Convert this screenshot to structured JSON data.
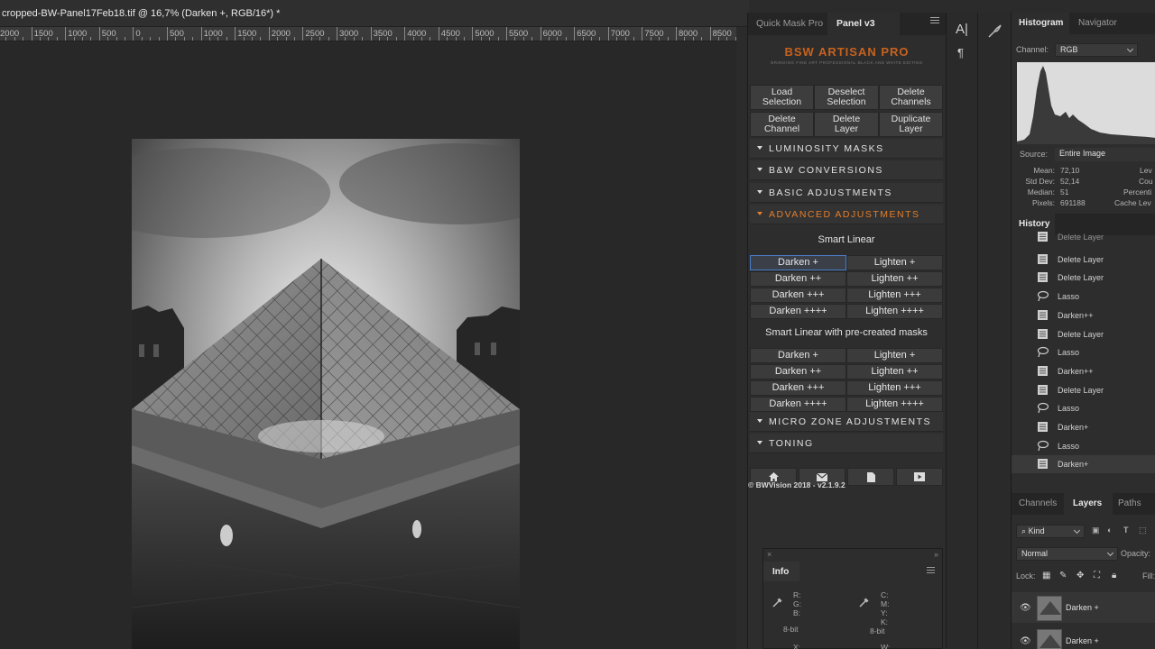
{
  "document": {
    "title": "cropped-BW-Panel17Feb18.tif @ 16,7% (Darken +, RGB/16*) *"
  },
  "ruler": {
    "ticks": [
      "2000",
      "1500",
      "1000",
      "500",
      "0",
      "500",
      "1000",
      "1500",
      "2000",
      "2500",
      "3000",
      "3500",
      "4000",
      "4500",
      "5000",
      "5500",
      "6000",
      "6500",
      "7000",
      "7500",
      "8000",
      "8500"
    ]
  },
  "bwa_panel": {
    "tabs": [
      "Quick Mask Pro",
      "Panel v3"
    ],
    "logo": "BSW ARTISAN PRO",
    "logo_sub": "BRINGING FINE ART PROFESSIONAL BLACK AND WHITE EDITING",
    "buttons": [
      [
        "Load",
        "Selection"
      ],
      [
        "Deselect",
        "Selection"
      ],
      [
        "Delete",
        "Channels"
      ],
      [
        "Delete",
        "Channel"
      ],
      [
        "Delete",
        "Layer"
      ],
      [
        "Duplicate",
        "Layer"
      ]
    ],
    "sections": {
      "luminosity": "LUMINOSITY MASKS",
      "bw": "B&W CONVERSIONS",
      "basic": "BASIC ADJUSTMENTS",
      "advanced": "ADVANCED ADJUSTMENTS",
      "micro": "MICRO ZONE ADJUSTMENTS",
      "toning": "TONING"
    },
    "smart_linear_heading": "Smart Linear",
    "smart_linear": {
      "darken": [
        "Darken +",
        "Darken ++",
        "Darken +++",
        "Darken ++++"
      ],
      "lighten": [
        "Lighten +",
        "Lighten ++",
        "Lighten +++",
        "Lighten ++++"
      ]
    },
    "smart_linear_masks_heading": "Smart Linear with pre-created masks",
    "smart_linear_masks": {
      "darken": [
        "Darken +",
        "Darken ++",
        "Darken +++",
        "Darken ++++"
      ],
      "lighten": [
        "Lighten +",
        "Lighten ++",
        "Lighten +++",
        "Lighten ++++"
      ]
    },
    "footer_icons": [
      "home-icon",
      "mail-icon",
      "document-icon",
      "video-icon"
    ],
    "copyright": "© BWVision 2018 - v2.1.9.2",
    "active_color": "#e57e2a"
  },
  "info_panel": {
    "title": "Info",
    "left_labels": [
      "R:",
      "G:",
      "B:"
    ],
    "left_depth": "8-bit",
    "right_labels": [
      "C:",
      "M:",
      "Y:",
      "K:"
    ],
    "right_depth": "8-bit",
    "bottom_left": "X:",
    "bottom_right": "W:"
  },
  "histogram": {
    "tabs": [
      "Histogram",
      "Navigator"
    ],
    "channel_label": "Channel:",
    "channel_value": "RGB",
    "source_label": "Source:",
    "source_value": "Entire Image",
    "stats": [
      {
        "label": "Mean:",
        "value": "72,10"
      },
      {
        "label": "Std Dev:",
        "value": "52,14"
      },
      {
        "label": "Median:",
        "value": "51"
      },
      {
        "label": "Pixels:",
        "value": "691188"
      }
    ],
    "right_stats": [
      "Lev",
      "Cou",
      "Percenti",
      "Cache Lev"
    ]
  },
  "history": {
    "title": "History",
    "items": [
      {
        "label": "Delete Layer",
        "icon": "document-icon"
      },
      {
        "label": "Delete Layer",
        "icon": "document-icon"
      },
      {
        "label": "Delete Layer",
        "icon": "document-icon"
      },
      {
        "label": "Lasso",
        "icon": "lasso-icon"
      },
      {
        "label": "Darken++",
        "icon": "document-icon"
      },
      {
        "label": "Delete Layer",
        "icon": "document-icon"
      },
      {
        "label": "Lasso",
        "icon": "lasso-icon"
      },
      {
        "label": "Darken++",
        "icon": "document-icon"
      },
      {
        "label": "Delete Layer",
        "icon": "document-icon"
      },
      {
        "label": "Lasso",
        "icon": "lasso-icon"
      },
      {
        "label": "Darken+",
        "icon": "document-icon"
      },
      {
        "label": "Lasso",
        "icon": "lasso-icon"
      },
      {
        "label": "Darken+",
        "icon": "document-icon"
      }
    ]
  },
  "layers": {
    "tabs": [
      "Channels",
      "Layers",
      "Paths"
    ],
    "kind_label": "Kind",
    "blend_mode": "Normal",
    "opacity_label": "Opacity:",
    "lock_label": "Lock:",
    "fill_label": "Fill:",
    "items": [
      {
        "name": "Darken +"
      },
      {
        "name": "Darken +"
      }
    ]
  },
  "tools": {
    "character": "A|",
    "paragraph": "¶"
  }
}
